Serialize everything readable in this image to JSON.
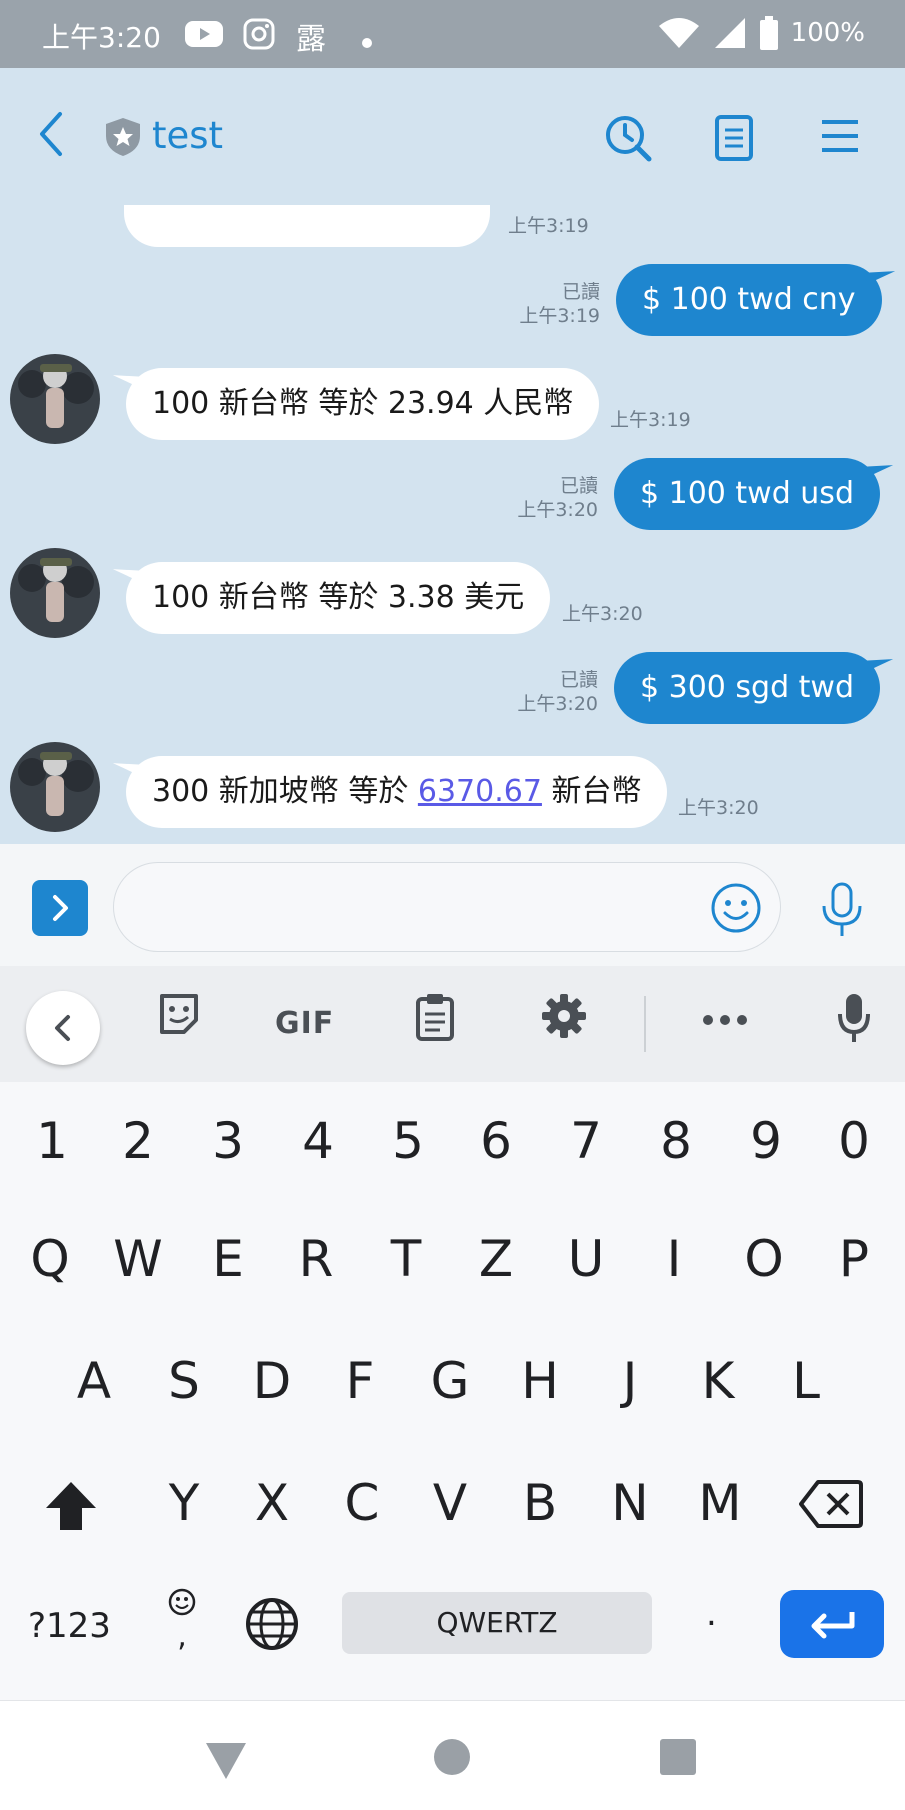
{
  "status_bar": {
    "time": "上午3:20",
    "notification_char": "露",
    "battery": "100%"
  },
  "chat": {
    "title": "test",
    "messages": [
      {
        "direction": "in",
        "text": "",
        "time": "上午3:19"
      },
      {
        "direction": "out",
        "text": "$ 100 twd cny",
        "read": "已讀",
        "time": "上午3:19"
      },
      {
        "direction": "in",
        "text": "100 新台幣 等於 23.94 人民幣",
        "time": "上午3:19"
      },
      {
        "direction": "out",
        "text": "$ 100 twd usd",
        "read": "已讀",
        "time": "上午3:20"
      },
      {
        "direction": "in",
        "text": "100 新台幣 等於 3.38 美元",
        "time": "上午3:20"
      },
      {
        "direction": "out",
        "text": "$ 300 sgd twd",
        "read": "已讀",
        "time": "上午3:20"
      },
      {
        "direction": "in",
        "text_before": "300 新加坡幣 等於 ",
        "link": "6370.67",
        "text_after": " 新台幣",
        "time": "上午3:20"
      }
    ]
  },
  "input": {
    "value": "",
    "placeholder": ""
  },
  "keyboard": {
    "toolbar": {
      "gif_label": "GIF"
    },
    "row_numbers": [
      "1",
      "2",
      "3",
      "4",
      "5",
      "6",
      "7",
      "8",
      "9",
      "0"
    ],
    "row_1": [
      "Q",
      "W",
      "E",
      "R",
      "T",
      "Z",
      "U",
      "I",
      "O",
      "P"
    ],
    "row_2": [
      "A",
      "S",
      "D",
      "F",
      "G",
      "H",
      "J",
      "K",
      "L"
    ],
    "row_3": [
      "Y",
      "X",
      "C",
      "V",
      "B",
      "N",
      "M"
    ],
    "symbols_label": "?123",
    "comma_label": ",",
    "space_label": "QWERTZ",
    "period_label": "."
  },
  "colors": {
    "accent": "#1e86cf",
    "chat_background": "#d3e3ef",
    "status_bar": "#9aa3ab",
    "enter_key": "#1a73e8"
  },
  "icons": {
    "status_bar": [
      "youtube-icon",
      "instagram-icon",
      "dot-icon",
      "wifi-icon",
      "signal-icon",
      "battery-icon"
    ],
    "header": [
      "back-icon",
      "shield-star-icon",
      "search-history-icon",
      "notes-icon",
      "menu-icon"
    ],
    "input_bar": [
      "expand-icon",
      "emoji-icon",
      "microphone-icon"
    ],
    "keyboard_toolbar": [
      "chevron-left-icon",
      "sticker-icon",
      "clipboard-icon",
      "settings-icon",
      "more-icon",
      "microphone-icon"
    ],
    "navigation": [
      "back-triangle-icon",
      "home-circle-icon",
      "recents-square-icon"
    ]
  }
}
